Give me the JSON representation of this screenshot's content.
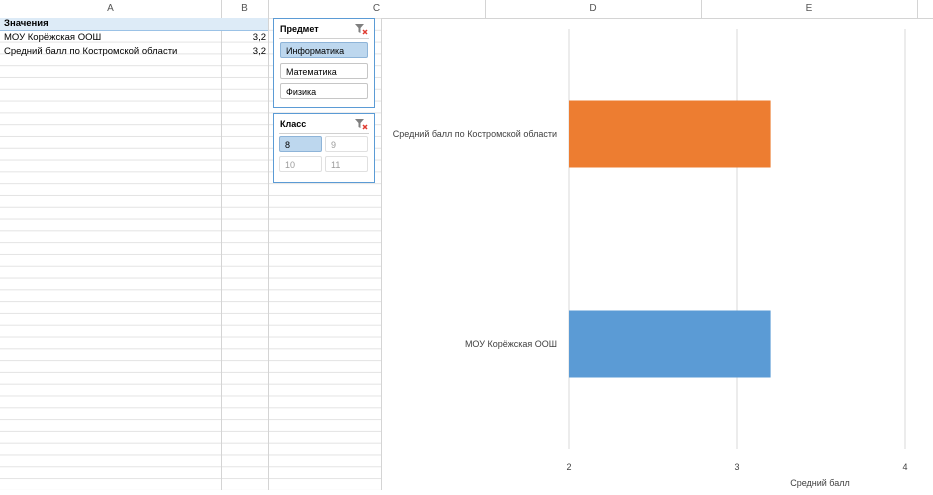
{
  "columns": [
    "A",
    "B",
    "C",
    "D",
    "E"
  ],
  "pivot": {
    "header": "Значения",
    "rows": [
      {
        "label": "МОУ Корёжская ООШ",
        "value": "3,2"
      },
      {
        "label": "Средний балл по Костромской области",
        "value": "3,2"
      }
    ]
  },
  "slicers": {
    "subject": {
      "title": "Предмет",
      "items": [
        {
          "label": "Информатика",
          "selected": true
        },
        {
          "label": "Математика",
          "selected": false
        },
        {
          "label": "Физика",
          "selected": false
        }
      ]
    },
    "class": {
      "title": "Класс",
      "items": [
        {
          "label": "8",
          "selected": true,
          "available": true
        },
        {
          "label": "9",
          "selected": false,
          "available": false
        },
        {
          "label": "10",
          "selected": false,
          "available": false
        },
        {
          "label": "11",
          "selected": false,
          "available": false
        }
      ]
    }
  },
  "chart_data": {
    "type": "bar",
    "orientation": "horizontal",
    "categories": [
      "Средний балл по Костромской области",
      "МОУ Корёжская ООШ"
    ],
    "values": [
      3.2,
      3.2
    ],
    "colors": [
      "#ed7d31",
      "#5b9bd5"
    ],
    "xlabel": "Средний балл",
    "xlim": [
      2,
      4
    ],
    "ticks": [
      "2",
      "3",
      "4"
    ],
    "grid": true
  }
}
